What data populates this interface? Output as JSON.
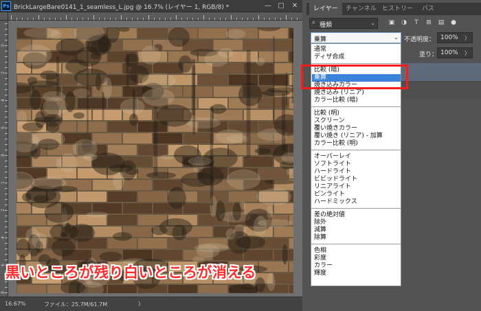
{
  "document": {
    "app_icon": "Ps",
    "title": "BrickLargeBare0141_1_seamless_L.jpg @ 16.7% (レイヤー 1, RGB/8) *",
    "window_controls": {
      "minimize": "—",
      "maximize": "□",
      "close": "✕"
    },
    "ruler_vertical_numbers": [
      "0",
      "2",
      "4",
      "6",
      "8",
      "1",
      "2",
      "4",
      "6",
      "8"
    ]
  },
  "status_bar": {
    "zoom": "16.67%",
    "file_info": "ファイル：25.7M/61.7M",
    "arrow": "〉"
  },
  "caption": "黒いところが残り白いところが消える",
  "panel": {
    "tabs": [
      {
        "label": "レイヤー",
        "active": true
      },
      {
        "label": "チャンネル",
        "active": false
      },
      {
        "label": "ヒストリー",
        "active": false
      },
      {
        "label": "パス",
        "active": false
      }
    ],
    "filter": {
      "icon": "search-icon",
      "label": "種類",
      "chevron": "⌄"
    },
    "filter_icons": [
      "image-filter-icon",
      "adjustment-filter-icon",
      "type-filter-icon",
      "shape-filter-icon",
      "smart-object-filter-icon",
      "toggle-filter-icon"
    ],
    "blend_mode": {
      "value": "乗算",
      "chevron": "⌄"
    },
    "opacity": {
      "label": "不透明度：",
      "value": "100%",
      "chevron": "〉"
    },
    "fill": {
      "label": "塗り：",
      "value": "100%",
      "chevron": "〉"
    }
  },
  "blend_menu": {
    "groups": [
      [
        "通常",
        "ディザ合成"
      ],
      [
        "比較 (暗)",
        "乗算",
        "焼き込みカラー",
        "焼き込み (リニア)",
        "カラー比較 (暗)"
      ],
      [
        "比較 (明)",
        "スクリーン",
        "覆い焼きカラー",
        "覆い焼き (リニア) - 加算",
        "カラー比較 (明)"
      ],
      [
        "オーバーレイ",
        "ソフトライト",
        "ハードライト",
        "ビビッドライト",
        "リニアライト",
        "ピンライト",
        "ハードミックス"
      ],
      [
        "差の絶対値",
        "除外",
        "減算",
        "除算"
      ],
      [
        "色相",
        "彩度",
        "カラー",
        "輝度"
      ]
    ],
    "highlighted": "乗算"
  },
  "colors": {
    "highlight": "#3b82db",
    "annotation_box": "#ff1a1a",
    "caption_text": "#ff2a2a"
  }
}
